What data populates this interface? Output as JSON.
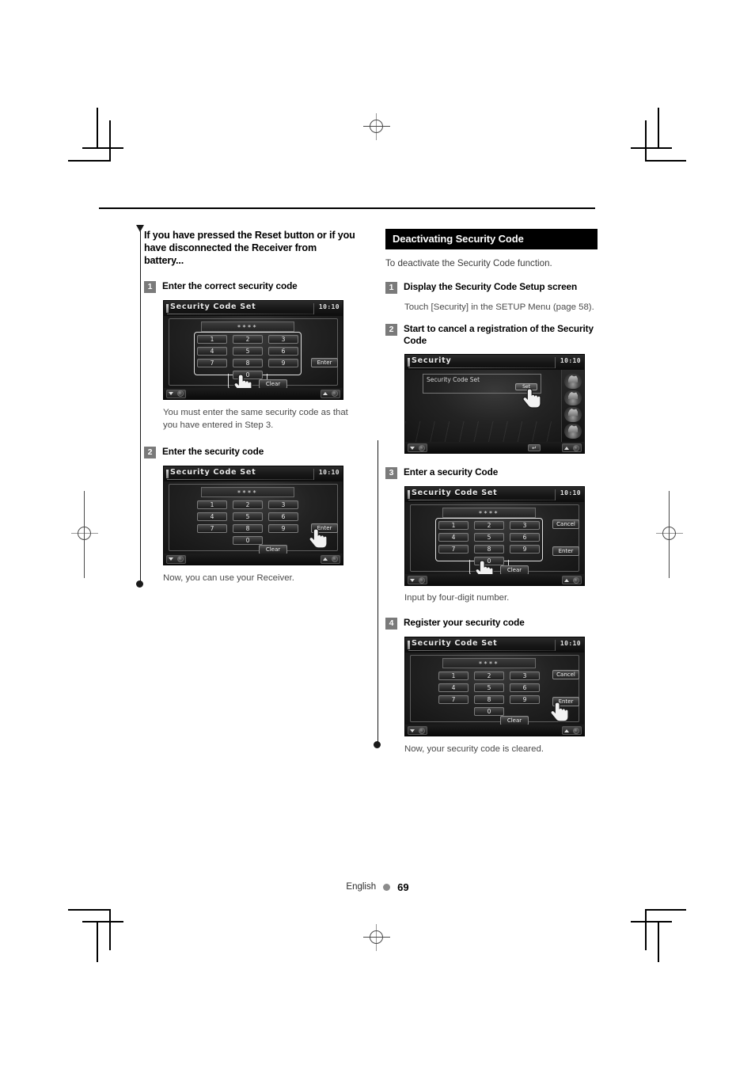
{
  "document": {
    "footer": {
      "language": "English",
      "page_number": "69",
      "dot_icon": "bullet-dot"
    }
  },
  "left_column": {
    "lead_heading": "If you have pressed the Reset button or if you have disconnected the Receiver from battery...",
    "steps": [
      {
        "number": "1",
        "title": "Enter the correct security code",
        "note": "You must enter the same security code as that you have entered in Step 3.",
        "screen": {
          "title": "Security Code Set",
          "clock": "10:10",
          "code_value": "****",
          "keys": [
            "1",
            "2",
            "3",
            "4",
            "5",
            "6",
            "7",
            "8",
            "9",
            "0"
          ],
          "side_buttons": [
            "Enter"
          ],
          "clear_label": "Clear",
          "cursor_target": "key-0"
        }
      },
      {
        "number": "2",
        "title": "Enter the security code",
        "note": "Now, you can use your Receiver.",
        "screen": {
          "title": "Security Code Set",
          "clock": "10:10",
          "code_value": "****",
          "keys": [
            "1",
            "2",
            "3",
            "4",
            "5",
            "6",
            "7",
            "8",
            "9",
            "0"
          ],
          "side_buttons": [
            "Enter"
          ],
          "clear_label": "Clear",
          "cursor_target": "enter-button"
        }
      }
    ]
  },
  "right_column": {
    "section_title": "Deactivating Security Code",
    "intro": "To deactivate the Security Code function.",
    "steps": [
      {
        "number": "1",
        "title": "Display the Security Code Setup screen",
        "substep": "Touch [Security] in the SETUP Menu (page 58)."
      },
      {
        "number": "2",
        "title": "Start to cancel a registration of the Security Code",
        "screen": {
          "title": "Security",
          "clock": "10:10",
          "row_label": "Security Code Set",
          "row_button": "Set",
          "return_icon": "return-arrow-icon",
          "source_icons": [
            "disc-source-icon",
            "usb-source-icon",
            "tuner-source-icon",
            "aux-source-icon"
          ],
          "cursor_target": "security-code-set-button"
        }
      },
      {
        "number": "3",
        "title": "Enter a security Code",
        "note": "Input by four-digit number.",
        "screen": {
          "title": "Security Code Set",
          "clock": "10:10",
          "code_value": "****",
          "keys": [
            "1",
            "2",
            "3",
            "4",
            "5",
            "6",
            "7",
            "8",
            "9",
            "0"
          ],
          "side_buttons": [
            "Cancel",
            "Enter"
          ],
          "clear_label": "Clear",
          "cursor_target": "key-0"
        }
      },
      {
        "number": "4",
        "title": "Register your security code",
        "note": "Now, your security code is cleared.",
        "screen": {
          "title": "Security Code Set",
          "clock": "10:10",
          "code_value": "****",
          "keys": [
            "1",
            "2",
            "3",
            "4",
            "5",
            "6",
            "7",
            "8",
            "9",
            "0"
          ],
          "side_buttons": [
            "Cancel",
            "Enter"
          ],
          "clear_label": "Clear",
          "cursor_target": "enter-button"
        }
      }
    ]
  }
}
